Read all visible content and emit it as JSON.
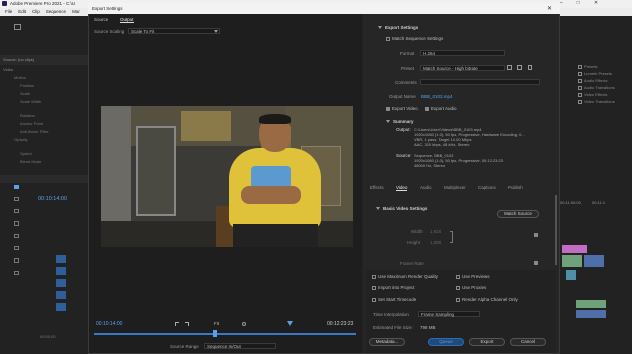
{
  "app": {
    "title": "Adobe Premiere Pro 2021 - C:\\U",
    "menu": [
      "File",
      "Edit",
      "Clip",
      "Sequence",
      "Mar"
    ],
    "window_controls": [
      "–",
      "□",
      "✕"
    ]
  },
  "dialog": {
    "title": "Export Settings",
    "close": "✕",
    "tabs": [
      "Source",
      "Output"
    ],
    "source_scaling": {
      "label": "Source Scaling",
      "value": "Scale To Fit"
    },
    "timecode_in": "00:10:14:00",
    "timecode_out": "00:12:23:23",
    "fit": "Fit",
    "source_range": {
      "label": "Source Range",
      "value": "Sequence In/Out"
    },
    "progress_fraction": 0.46
  },
  "export_settings": {
    "header": "Export Settings",
    "match_sequence": "Match Sequence Settings",
    "format": {
      "label": "Format",
      "value": "H.264"
    },
    "preset": {
      "label": "Preset",
      "value": "Match Source - High bitrate"
    },
    "comments": {
      "label": "Comments"
    },
    "output_name": {
      "label": "Output Name",
      "value": "BBB_0103.mp4"
    },
    "export_video": "Export Video",
    "export_audio": "Export Audio",
    "summary": {
      "header": "Summary",
      "output_label": "Output:",
      "output_lines": [
        "C:\\Users\\User\\Videos\\BBB_0103.mp4",
        "1920x1080 (1.0), 50 fps, Progressive, Hardware Encoding, 0...",
        "VBR, 1 pass, Target 10.00 Mbps",
        "AAC, 320 kbps, 48 kHz, Stereo"
      ],
      "source_label": "Source:",
      "source_lines": [
        "Sequence, BBB_0103",
        "1920x1080 (1.0), 50 fps, Progressive, 00:12:23:23",
        "48000 Hz, Stereo"
      ]
    }
  },
  "output_tabs": [
    "Effects",
    "Video",
    "Audio",
    "Multiplexer",
    "Captions",
    "Publish"
  ],
  "basic_video": {
    "header": "Basic Video Settings",
    "match_source": "Match Source",
    "width": {
      "label": "Width",
      "value": "1,920"
    },
    "height": {
      "label": "Height",
      "value": "1,080"
    },
    "frame_rate": {
      "label": "Frame Rate"
    }
  },
  "render_options": {
    "max_render": "Use Maximum Render Quality",
    "use_previews": "Use Previews",
    "import_project": "Import into Project",
    "use_proxies": "Use Proxies",
    "start_timecode": "Set Start Timecode",
    "alpha_only": "Render Alpha Channel Only",
    "time_interp": {
      "label": "Time Interpolation",
      "value": "Frame Sampling"
    },
    "file_size": {
      "label": "Estimated File Size:",
      "value": "798 MB"
    }
  },
  "buttons": {
    "metadata": "Metadata...",
    "queue": "Queue",
    "export": "Export",
    "cancel": "Cancel"
  },
  "bg_left": {
    "panel_title": "Source: (no clips)",
    "effect_controls": "Effect Controls",
    "video": "Video",
    "motion": "Motion",
    "position": "Position",
    "scale": "Scale",
    "scale_width": "Scale Width",
    "rotation": "Rotation",
    "anchor": "Anchor Point",
    "anti_flicker": "Anti-flicker Filter",
    "opacity": "Opacity",
    "speed": "Speed",
    "blend_mode": "Blend Mode",
    "timecode": "00:10:14:00",
    "timecode_small": "00:00:00"
  },
  "bg_right": {
    "items": [
      "Presets",
      "Lumetri Presets",
      "Audio Effects",
      "Audio Transitions",
      "Video Effects",
      "Video Transitions"
    ],
    "ruler": [
      "00:11:00:00",
      "00:11:1"
    ]
  }
}
